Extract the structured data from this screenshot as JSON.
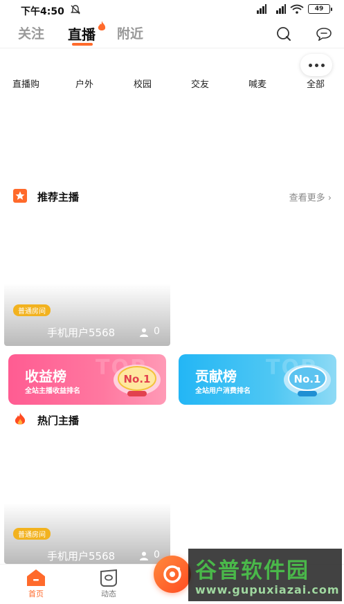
{
  "status_bar": {
    "time": "下午4:50",
    "battery": "49"
  },
  "top_tabs": [
    {
      "label": "关注"
    },
    {
      "label": "直播",
      "active": true
    },
    {
      "label": "附近"
    }
  ],
  "categories": [
    "直播购",
    "户外",
    "校园",
    "交友",
    "喊麦",
    "全部"
  ],
  "recommend": {
    "title": "推荐主播",
    "more": "查看更多"
  },
  "rooms": [
    {
      "tag": "普通房间",
      "name": "手机用户5568",
      "viewers": "0"
    },
    {
      "tag": "普通房间",
      "name": "手机用户5568",
      "viewers": "0"
    }
  ],
  "rankings": [
    {
      "title": "收益榜",
      "subtitle": "全站主播收益排名",
      "badge": "No.1",
      "bg_text": "TOP"
    },
    {
      "title": "贡献榜",
      "subtitle": "全站用户消费排名",
      "badge": "No.1",
      "bg_text": "TOP"
    }
  ],
  "hot": {
    "title": "热门主播"
  },
  "bottom_nav": [
    {
      "label": "首页",
      "active": true
    },
    {
      "label": "动态"
    }
  ],
  "watermark": {
    "title": "谷普软件园",
    "url": "www.gupuxiazai.com"
  },
  "colors": {
    "accent": "#ff6a2b",
    "tag": "#f2b21f",
    "income": "#ff5c92",
    "contrib": "#23b6f5"
  }
}
